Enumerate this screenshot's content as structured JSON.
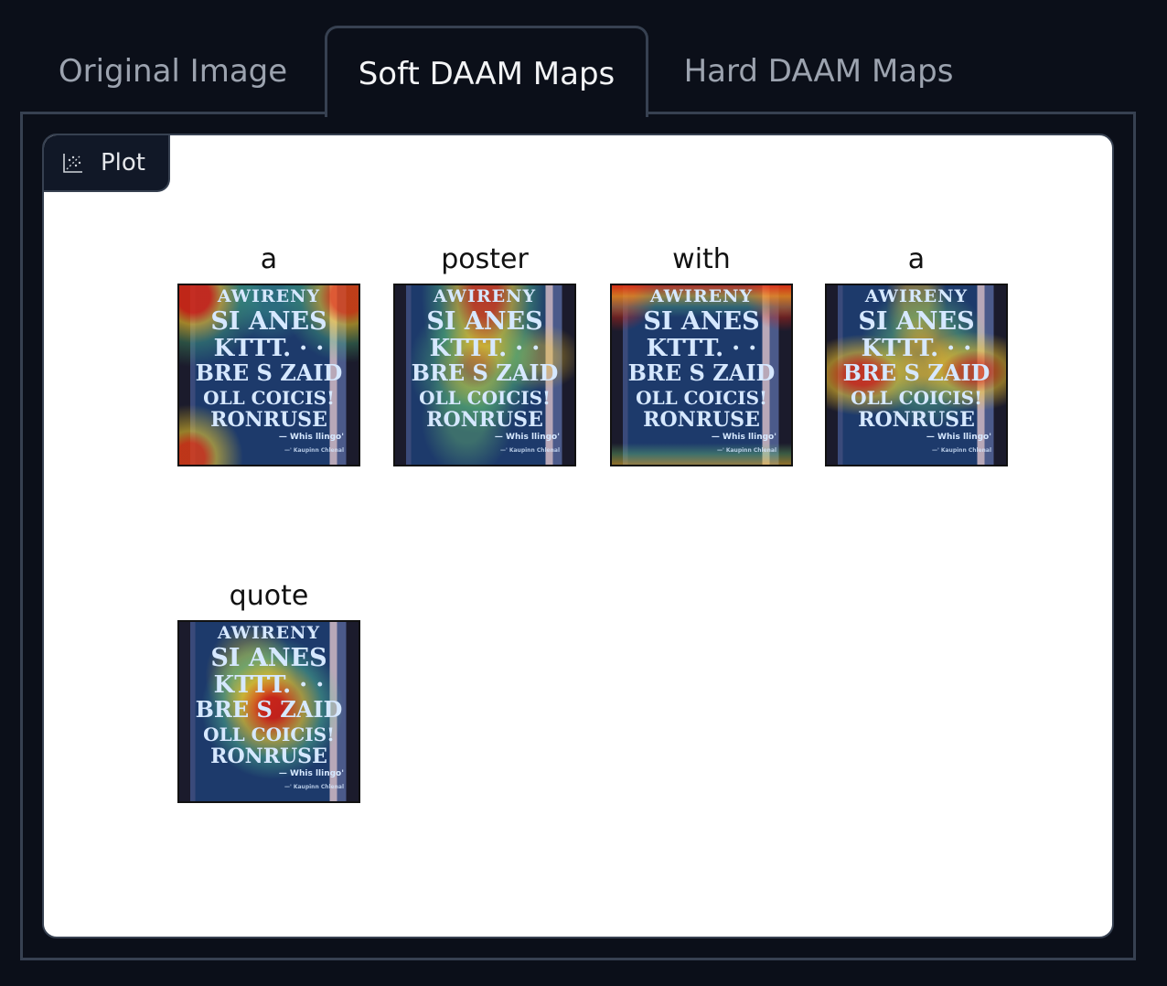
{
  "tabs": [
    {
      "label": "Original Image",
      "selected": false
    },
    {
      "label": "Soft DAAM Maps",
      "selected": true
    },
    {
      "label": "Hard DAAM Maps",
      "selected": false
    }
  ],
  "plot": {
    "label": "Plot",
    "icon": "chart-icon"
  },
  "colors": {
    "page_background": "#0b0f19",
    "border": "#374151",
    "tab_selected_text": "#f3f4f6",
    "tab_text": "#9ca3af",
    "plot_background": "#ffffff"
  },
  "subplots": [
    {
      "title": "a",
      "image": "heatmap-overlay",
      "hot": [
        "top-left",
        "top-right",
        "bottom-left"
      ]
    },
    {
      "title": "poster",
      "image": "heatmap-overlay",
      "hot": [
        "top",
        "middle"
      ]
    },
    {
      "title": "with",
      "image": "heatmap-overlay",
      "hot": [
        "top",
        "bottom"
      ]
    },
    {
      "title": "a",
      "image": "heatmap-overlay",
      "hot": [
        "center",
        "left",
        "right"
      ]
    },
    {
      "title": "quote",
      "image": "heatmap-overlay",
      "hot": [
        "center"
      ]
    }
  ],
  "poster_text": {
    "line1": "AWIRENY",
    "line2": "SI ANES",
    "line3": "KTTT. ·  ·",
    "line4": "BRE S ZAID",
    "line5": "OLL COICIS!",
    "line6": "RONRUSE",
    "line7": "— Whis llingo'",
    "line8": "—' Kaupinn Chlenal"
  }
}
